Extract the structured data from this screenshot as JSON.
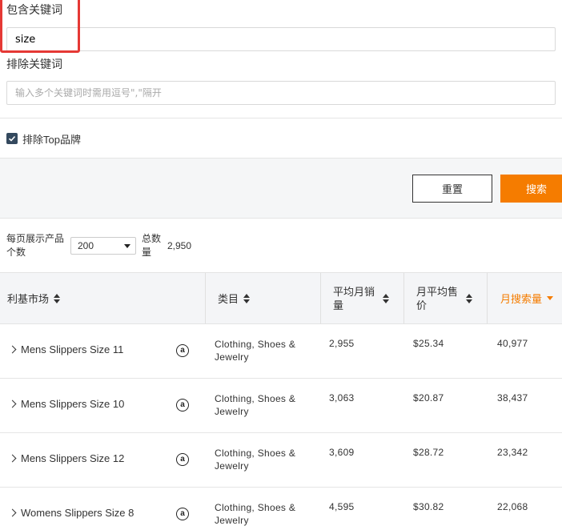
{
  "filters": {
    "include_label": "包含关键词",
    "include_value": "size",
    "exclude_label": "排除关键词",
    "exclude_placeholder": "输入多个关键词时需用逗号\",\"隔开",
    "exclude_top_brands_label": "排除Top品牌",
    "exclude_top_brands_checked": true
  },
  "actions": {
    "reset_label": "重置",
    "search_label": "搜索"
  },
  "pagination": {
    "per_page_label": "每页展示产品个数",
    "per_page_value": "200",
    "total_label": "总数量",
    "total_value": "2,950"
  },
  "table": {
    "columns": [
      "利基市场",
      "类目",
      "平均月销量",
      "月平均售价",
      "月搜索量"
    ],
    "rows": [
      {
        "keyword": "Mens Slippers Size 11",
        "category": "Clothing, Shoes & Jewelry",
        "avg_monthly_sales": "2,955",
        "avg_price": "$25.34",
        "monthly_searches": "40,977"
      },
      {
        "keyword": "Mens Slippers Size 10",
        "category": "Clothing, Shoes & Jewelry",
        "avg_monthly_sales": "3,063",
        "avg_price": "$20.87",
        "monthly_searches": "38,437"
      },
      {
        "keyword": "Mens Slippers Size 12",
        "category": "Clothing, Shoes & Jewelry",
        "avg_monthly_sales": "3,609",
        "avg_price": "$28.72",
        "monthly_searches": "23,342"
      },
      {
        "keyword": "Womens Slippers Size 8",
        "category": "Clothing, Shoes & Jewelry",
        "avg_monthly_sales": "4,595",
        "avg_price": "$30.82",
        "monthly_searches": "22,068"
      }
    ]
  },
  "icons": {
    "marketplace": "amazon-icon",
    "expand": "chevron-right-icon"
  },
  "colors": {
    "accent": "#f57c00",
    "highlight": "#e53935",
    "checkbox": "#34495e"
  }
}
